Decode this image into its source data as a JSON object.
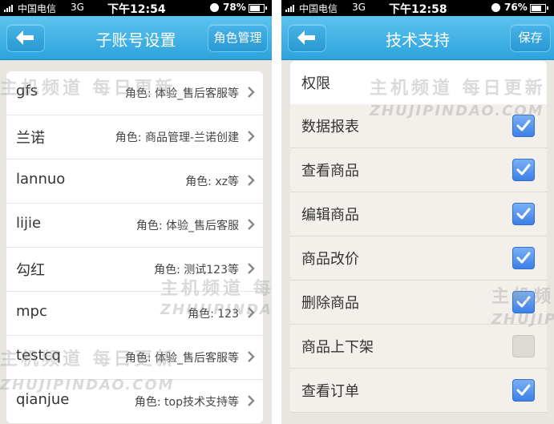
{
  "left": {
    "status": {
      "carrier": "中国电信",
      "network": "3G",
      "time": "下午12:54",
      "battery": "78%",
      "battery_level": 0.78
    },
    "title": "子账号设置",
    "right_button": "角色管理",
    "accounts": [
      {
        "name": "gfs",
        "role": "角色: 体验_售后客服等"
      },
      {
        "name": "兰诺",
        "role": "角色: 商品管理-兰诺创建"
      },
      {
        "name": "lannuo",
        "role": "角色: xz等"
      },
      {
        "name": "lijie",
        "role": "角色: 体验_售后客服"
      },
      {
        "name": "勾红",
        "role": "角色: 测试123等"
      },
      {
        "name": "mpc",
        "role": "角色: 123"
      },
      {
        "name": "testcq",
        "role": "角色: 体验_售后客服等"
      },
      {
        "name": "qianjue",
        "role": "角色: top技术支持等"
      }
    ]
  },
  "right": {
    "status": {
      "carrier": "中国电信",
      "network": "3G",
      "time": "下午12:58",
      "battery": "76%",
      "battery_level": 0.76
    },
    "title": "技术支持",
    "right_button": "保存",
    "section_header": "权限",
    "permissions": [
      {
        "label": "数据报表",
        "checked": true
      },
      {
        "label": "查看商品",
        "checked": true
      },
      {
        "label": "编辑商品",
        "checked": true
      },
      {
        "label": "商品改价",
        "checked": true
      },
      {
        "label": "删除商品",
        "checked": true
      },
      {
        "label": "商品上下架",
        "checked": false
      },
      {
        "label": "查看订单",
        "checked": true
      }
    ]
  },
  "watermark": {
    "cn": "主机频道 每日更新",
    "en": "ZHUJIPINDAO.COM"
  },
  "colors": {
    "nav_blue": "#2da3dc",
    "checkbox_blue": "#3c7fe6",
    "page_bg": "#e9e6e1"
  },
  "icons": {
    "back": "arrow-left-icon",
    "row": "chevron-right-icon",
    "check": "checkmark-icon"
  }
}
